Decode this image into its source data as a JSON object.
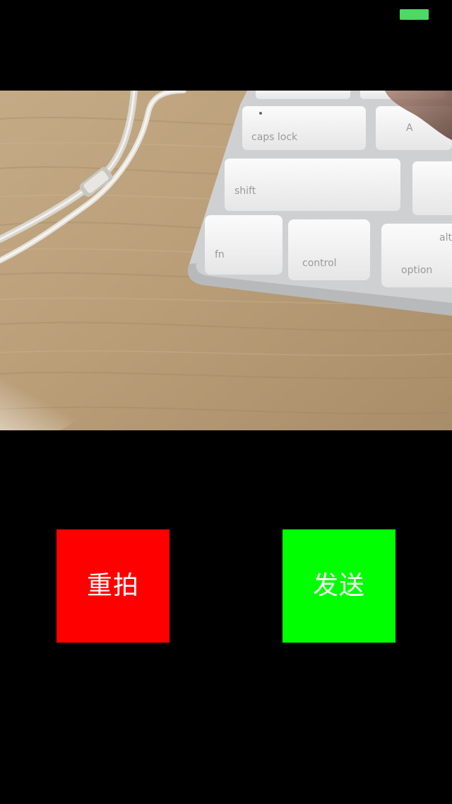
{
  "status_bar": {
    "battery_icon": "battery-icon",
    "battery_level": 1.0,
    "battery_color": "#4cd964"
  },
  "preview": {
    "subject_icon": "keyboard-photo",
    "key_labels": {
      "caps": "caps lock",
      "a_key": "A",
      "shift": "shift",
      "fn": "fn",
      "control": "control",
      "alt": "alt",
      "option": "option"
    }
  },
  "actions": {
    "retake_label": "重拍",
    "retake_color": "#ff0000",
    "send_label": "发送",
    "send_color": "#00ff00"
  }
}
